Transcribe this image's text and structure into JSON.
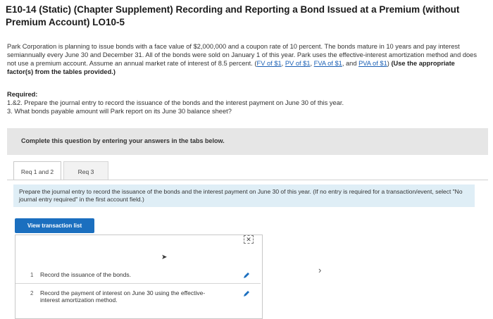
{
  "header": {
    "title": "E10-14 (Static) (Chapter Supplement) Recording and Reporting a Bond Issued at a Premium (without Premium Account) LO10-5"
  },
  "problem": {
    "text": "Park Corporation is planning to issue bonds with a face value of $2,000,000 and a coupon rate of 10 percent. The bonds mature in 10 years and pay interest semiannually every June 30 and December 31. All of the bonds were sold on January 1 of this year. Park uses the effective-interest amortization method and does not use a premium account. Assume an annual market rate of interest of 8.5 percent.",
    "links": [
      "FV of $1",
      "PV of $1",
      "FVA of $1",
      "PVA of $1"
    ],
    "sep1": ", ",
    "sep2": ", ",
    "sep3": ", and ",
    "paren_open": " (",
    "paren_close": ")",
    "emphasis": " (Use the appropriate factor(s) from the tables provided.)"
  },
  "required": {
    "label": "Required:",
    "items": [
      "1.&2. Prepare the journal entry to record the issuance of the bonds and the interest payment on June 30 of this year.",
      "3. What bonds payable amount will Park report on its June 30 balance sheet?"
    ]
  },
  "instructions": {
    "complete": "Complete this question by entering your answers in the tabs below."
  },
  "tabs": [
    {
      "label": "Req 1 and 2",
      "active": true
    },
    {
      "label": "Req 3",
      "active": false
    }
  ],
  "tab_instruction": "Prepare the journal entry to record the issuance of the bonds and the interest payment on June 30 of this year. (If no entry is required for a transaction/event, select \"No journal entry required\" in the first account field.)",
  "transaction_button": "View transaction list",
  "transactions": [
    {
      "num": "1",
      "desc": "Record the issuance of the bonds."
    },
    {
      "num": "2",
      "desc": "Record the payment of interest on June 30 using the effective-interest amortization method."
    }
  ],
  "colors": {
    "link": "#1a5fb4",
    "button": "#1b6fbf",
    "instruction_bg": "#dfeef6",
    "pencil": "#1b6fbf"
  }
}
